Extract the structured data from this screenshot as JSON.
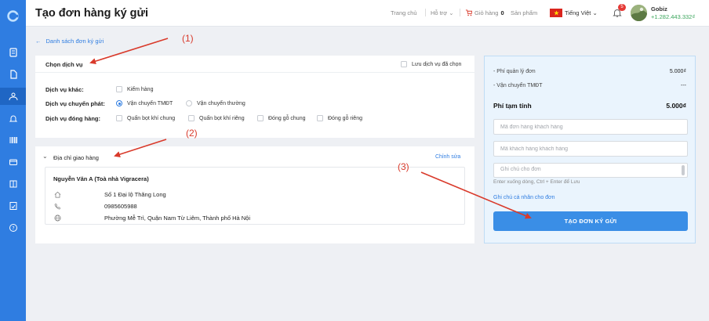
{
  "header": {
    "title": "Tạo đơn hàng ký gửi",
    "nav_home": "Trang chủ",
    "nav_support": "Hỗ trợ",
    "nav_cart": "Giỏ hàng",
    "cart_count": "0",
    "nav_products": "Sản phẩm",
    "language": "Tiếng Việt",
    "notification_count": "5",
    "user_name": "Gobiz",
    "user_balance": "+1.282.443.332₫"
  },
  "breadcrumb": {
    "back_label": "Danh sách đơn ký gửi"
  },
  "service": {
    "title": "Chọn dịch vụ",
    "save_label": "Lưu dịch vụ đã chọn",
    "other_label": "Dịch vụ khác:",
    "other_options": [
      "Kiểm hàng"
    ],
    "shipping_label": "Dịch vụ chuyển phát:",
    "shipping_options": [
      "Vận chuyển TMĐT",
      "Vận chuyển thường"
    ],
    "shipping_selected": 0,
    "packing_label": "Dịch vụ đóng hàng:",
    "packing_options": [
      "Quấn bọt khí chung",
      "Quấn bọt khí riêng",
      "Đóng gỗ chung",
      "Đóng gỗ riêng"
    ]
  },
  "address": {
    "title": "Địa chỉ giao hàng",
    "edit_label": "Chỉnh sửa",
    "recipient": "Nguyễn Văn A (Toà nhà Vigracera)",
    "street": "Số 1 Đại lộ Thăng Long",
    "phone": "0985605988",
    "area": "Phường Mễ Trì, Quận Nam Từ Liêm, Thành phố Hà Nội"
  },
  "summary": {
    "fee_label": "- Phí quản lý đơn",
    "fee_value": "5.000₫",
    "shipping_label": "- Vận chuyển TMĐT",
    "shipping_value": "---",
    "total_label": "Phí tạm tính",
    "total_value": "5.000₫",
    "order_code_placeholder": "Mã đơn hàng khách hàng",
    "customer_code_placeholder": "Mã khách hàng khách hàng",
    "note_placeholder": "Ghi chú cho đơn",
    "note_hint": "Enter xuống dòng, Ctrl + Enter để Lưu",
    "personal_note_link": "Ghi chú cá nhân cho đơn",
    "submit_label": "TẠO ĐƠN KÝ GỬI"
  },
  "annotations": [
    "(1)",
    "(2)",
    "(3)"
  ],
  "colors": {
    "primary": "#2f7de1",
    "annotation": "#d93a2b",
    "balance": "#3aa55b"
  }
}
